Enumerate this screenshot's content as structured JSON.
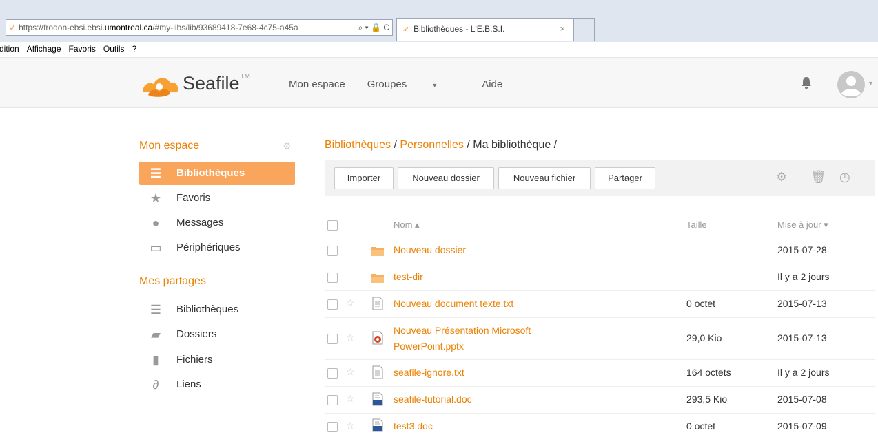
{
  "browser": {
    "url_prefix": "https://",
    "url_host_pre": "frodon-ebsi.ebsi.",
    "url_host_dom": "umontreal.ca",
    "url_rest": "/#my-libs/lib/93689418-7e68-4c75-a45a",
    "address_icons": "⌕ ▾ 🔒 C",
    "tab_title": "Bibliothèques - L'E.B.S.I.",
    "tab_close": "×",
    "menu": [
      "dition",
      "Affichage",
      "Favoris",
      "Outils",
      "?"
    ]
  },
  "header": {
    "logo_text": "Seafile",
    "logo_tm": "TM",
    "nav": [
      "Mon espace",
      "Groupes",
      "Aide"
    ]
  },
  "sidebar": {
    "section1_title": "Mon espace",
    "section1_items": [
      {
        "label": "Bibliothèques",
        "icon": "library-icon"
      },
      {
        "label": "Favoris",
        "icon": "star-icon"
      },
      {
        "label": "Messages",
        "icon": "messages-icon"
      },
      {
        "label": "Périphériques",
        "icon": "monitor-icon"
      }
    ],
    "section2_title": "Mes partages",
    "section2_items": [
      {
        "label": "Bibliothèques",
        "icon": "library-icon"
      },
      {
        "label": "Dossiers",
        "icon": "folder-icon"
      },
      {
        "label": "Fichiers",
        "icon": "file-icon"
      },
      {
        "label": "Liens",
        "icon": "link-icon"
      }
    ]
  },
  "breadcrumb": {
    "part1": "Bibliothèques",
    "sep1": " / ",
    "part2": "Personnelles",
    "sep2": " / ",
    "part3": "Ma bibliothèque",
    "sep3": " /"
  },
  "toolbar": {
    "buttons": [
      "Importer",
      "Nouveau dossier",
      "Nouveau fichier",
      "Partager"
    ]
  },
  "table": {
    "col_name": "Nom ▴",
    "col_size": "Taille",
    "col_date": "Mise à jour ▾",
    "rows": [
      {
        "name": "Nouveau dossier",
        "name2": "",
        "size": "",
        "date": "2015-07-28",
        "type": "folder"
      },
      {
        "name": "test-dir",
        "name2": "",
        "size": "",
        "date": "Il y a 2 jours",
        "type": "folder"
      },
      {
        "name": "Nouveau document texte.txt",
        "name2": "",
        "size": "0 octet",
        "date": "2015-07-13",
        "type": "text"
      },
      {
        "name": "Nouveau Présentation Microsoft",
        "name2": "PowerPoint.pptx",
        "size": "29,0 Kio",
        "date": "2015-07-13",
        "type": "ppt"
      },
      {
        "name": "seafile-ignore.txt",
        "name2": "",
        "size": "164 octets",
        "date": "Il y a 2 jours",
        "type": "text"
      },
      {
        "name": "seafile-tutorial.doc",
        "name2": "",
        "size": "293,5 Kio",
        "date": "2015-07-08",
        "type": "doc"
      },
      {
        "name": "test3.doc",
        "name2": "",
        "size": "0 octet",
        "date": "2015-07-09",
        "type": "doc"
      }
    ]
  },
  "colors": {
    "accent": "#eb8205",
    "active_bg": "#f9a55c"
  }
}
